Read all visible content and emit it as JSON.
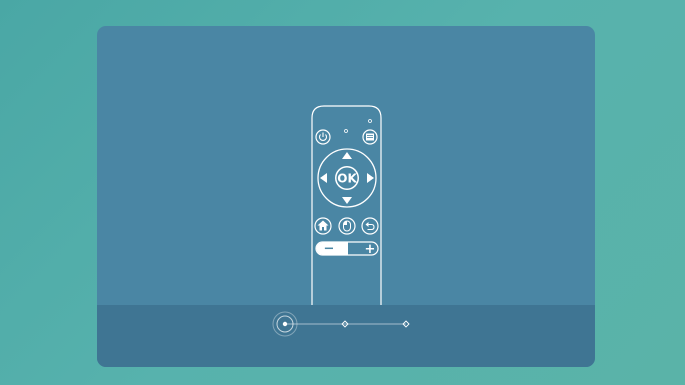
{
  "remote": {
    "ok_label": "OK",
    "volume_down_symbol": "−",
    "volume_up_symbol": "+",
    "icons": [
      "power-icon",
      "menu-icon",
      "arrow-up-icon",
      "arrow-down-icon",
      "arrow-left-icon",
      "arrow-right-icon",
      "home-icon",
      "mouse-icon",
      "back-icon"
    ]
  },
  "pager": {
    "total_steps": 3,
    "current_step": 1
  },
  "colors": {
    "background": "#4aa7a5",
    "panel": "#4a86a4",
    "footer": "#3f7593",
    "outline": "#ffffff"
  }
}
